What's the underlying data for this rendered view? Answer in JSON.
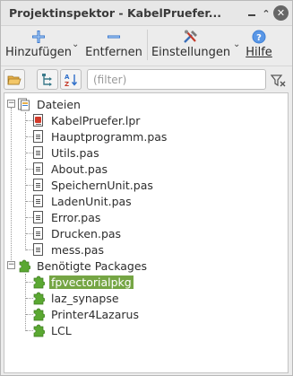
{
  "window": {
    "title": "Projektinspektor - KabelPruefer...",
    "minimize_glyph": "",
    "maximize_glyph": "⌃",
    "close_glyph": "✕"
  },
  "toolbar": {
    "add_label": "Hinzufügen",
    "remove_label": "Entfernen",
    "settings_label": "Einstellungen",
    "help_label": "Hilfe",
    "dropdown_glyph": "⌄"
  },
  "filter": {
    "placeholder": "(filter)",
    "value": ""
  },
  "tree": {
    "files_group": {
      "label": "Dateien",
      "expander": "−",
      "items": [
        {
          "label": "KabelPruefer.lpr",
          "icon": "lpr-file-icon"
        },
        {
          "label": "Hauptprogramm.pas",
          "icon": "file-icon"
        },
        {
          "label": "Utils.pas",
          "icon": "file-icon"
        },
        {
          "label": "About.pas",
          "icon": "file-icon"
        },
        {
          "label": "SpeichernUnit.pas",
          "icon": "file-icon"
        },
        {
          "label": "LadenUnit.pas",
          "icon": "file-icon"
        },
        {
          "label": "Error.pas",
          "icon": "file-icon"
        },
        {
          "label": "Drucken.pas",
          "icon": "file-icon"
        },
        {
          "label": "mess.pas",
          "icon": "file-icon"
        }
      ]
    },
    "packages_group": {
      "label": "Benötigte Packages",
      "expander": "−",
      "items": [
        {
          "label": "fpvectorialpkg",
          "icon": "package-icon",
          "selected": true
        },
        {
          "label": "laz_synapse",
          "icon": "package-icon",
          "selected": false
        },
        {
          "label": "Printer4Lazarus",
          "icon": "package-icon",
          "selected": false
        },
        {
          "label": "LCL",
          "icon": "package-icon",
          "selected": false
        }
      ]
    }
  },
  "colors": {
    "selection": "#75a544",
    "package_green": "#5aa832",
    "add_blue": "#2f6fc9",
    "help_blue": "#3c7fd6"
  }
}
